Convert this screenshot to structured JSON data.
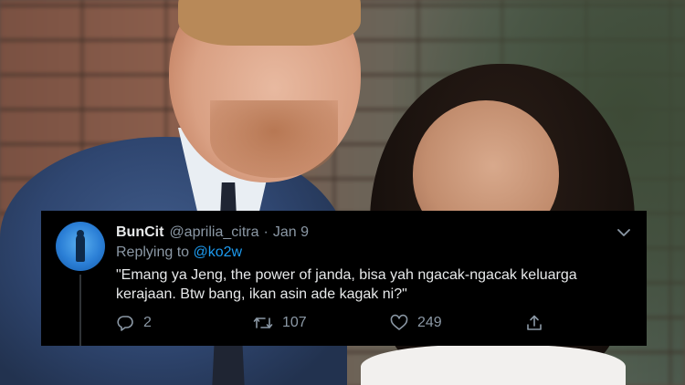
{
  "tweet": {
    "display_name": "BunCit",
    "handle": "@aprilia_citra",
    "separator": "·",
    "date": "Jan 9",
    "replying_prefix": "Replying to",
    "replying_handle": "@ko2w",
    "text": "\"Emang ya Jeng, the power of janda, bisa yah ngacak-ngacak keluarga kerajaan. Btw bang, ikan asin ade kagak ni?\"",
    "actions": {
      "reply_count": "2",
      "retweet_count": "107",
      "like_count": "249"
    }
  },
  "icons": {
    "avatar": "avatar",
    "more": "chevron-down-icon",
    "reply": "reply-icon",
    "retweet": "retweet-icon",
    "like": "heart-icon",
    "share": "share-icon"
  },
  "colors": {
    "card_background": "#000000",
    "primary_text": "#e7e9ea",
    "secondary_text": "#8b98a5",
    "link": "#1d9bf0"
  }
}
